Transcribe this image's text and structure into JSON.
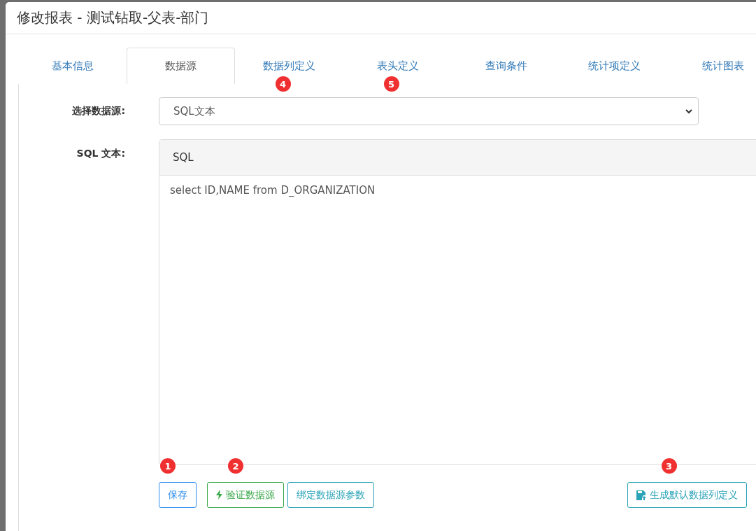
{
  "dialog": {
    "title": "修改报表 - 测试钻取-父表-部门"
  },
  "tabs": [
    {
      "label": "基本信息",
      "selected": false
    },
    {
      "label": "数据源",
      "selected": true
    },
    {
      "label": "数据列定义",
      "selected": false,
      "badge": "4"
    },
    {
      "label": "表头定义",
      "selected": false,
      "badge": "5"
    },
    {
      "label": "查询条件",
      "selected": false
    },
    {
      "label": "统计项定义",
      "selected": false
    },
    {
      "label": "统计图表",
      "selected": false
    }
  ],
  "form": {
    "datasource_label": "选择数据源:",
    "datasource_value": "SQL文本",
    "sql_label": "SQL 文本:",
    "sql_panel_title": "SQL",
    "sql_text": "select ID,NAME from D_ORGANIZATION"
  },
  "buttons": [
    {
      "label": "保存",
      "kind": "save",
      "badge": "1"
    },
    {
      "label": "验证数据源",
      "kind": "validate",
      "badge": "2"
    },
    {
      "label": "绑定数据源参数",
      "kind": "bind"
    },
    {
      "label": "生成默认数据列定义",
      "kind": "generate",
      "badge": "3"
    }
  ]
}
